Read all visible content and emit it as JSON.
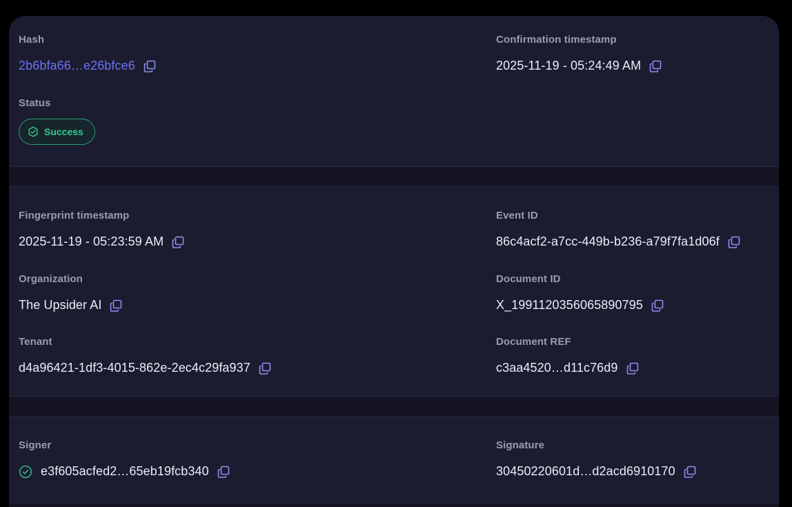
{
  "summary": {
    "hash": {
      "label": "Hash",
      "value": "2b6bfa66…e26bfce6"
    },
    "confirmation_timestamp": {
      "label": "Confirmation timestamp",
      "value": "2025-11-19 - 05:24:49 AM"
    },
    "status": {
      "label": "Status",
      "value": "Success"
    }
  },
  "details": {
    "fingerprint_timestamp": {
      "label": "Fingerprint timestamp",
      "value": "2025-11-19 - 05:23:59 AM"
    },
    "event_id": {
      "label": "Event ID",
      "value": "86c4acf2-a7cc-449b-b236-a79f7fa1d06f"
    },
    "organization": {
      "label": "Organization",
      "value": "The Upsider AI"
    },
    "document_id": {
      "label": "Document ID",
      "value": "X_1991120356065890795"
    },
    "tenant": {
      "label": "Tenant",
      "value": "d4a96421-1df3-4015-862e-2ec4c29fa937"
    },
    "document_ref": {
      "label": "Document REF",
      "value": "c3aa4520…d11c76d9"
    }
  },
  "signature": {
    "signer": {
      "label": "Signer",
      "value": "e3f605acfed2…65eb19fcb340"
    },
    "signature": {
      "label": "Signature",
      "value": "30450220601d…d2acd6910170"
    }
  },
  "colors": {
    "background": "#000000",
    "card": "#1b1c30",
    "divider": "#141424",
    "label": "#9a9cb2",
    "value": "#ecedf5",
    "link": "#6c73f2",
    "success": "#34c88e",
    "copy_icon": "#8e90ee"
  },
  "icons": {
    "copy": "copy-icon",
    "status": "shield-check-icon",
    "signer_verified": "check-circle-icon"
  }
}
